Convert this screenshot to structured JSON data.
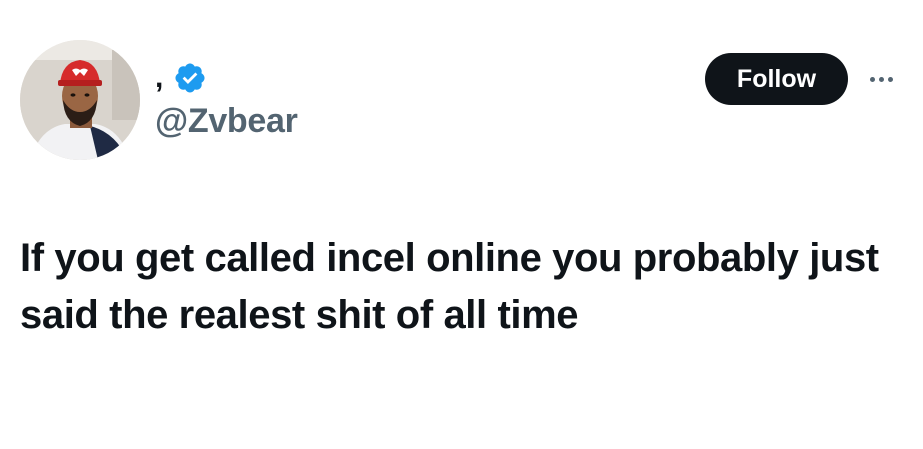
{
  "tweet": {
    "author": {
      "display_name": ",",
      "handle": "@Zvbear",
      "verified": true,
      "avatar_icon": "user-photo",
      "verified_color": "#1d9bf0"
    },
    "follow_label": "Follow",
    "more_icon": "ellipsis-icon",
    "text": "If you get called incel online you probably just said the realest shit of all time"
  },
  "colors": {
    "text_primary": "#0f1419",
    "text_secondary": "#536471",
    "follow_bg": "#0f1419",
    "follow_text": "#ffffff"
  }
}
